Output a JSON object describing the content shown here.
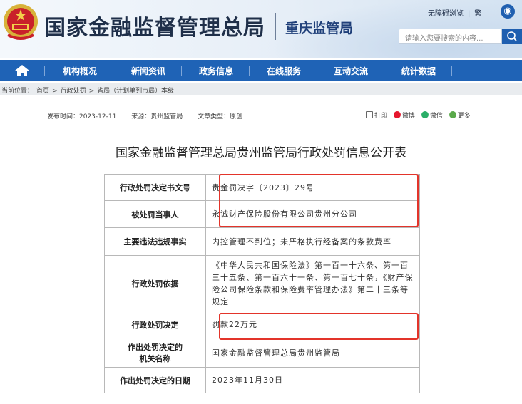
{
  "header": {
    "site_title": "国家金融监督管理总局",
    "branch_title": "重庆监管局",
    "accessible_label": "无障碍浏览",
    "traditional_label": "繁",
    "search_placeholder": "请输入您要搜索的内容...",
    "accent": "#1f63b6"
  },
  "nav": {
    "items": [
      "机构概况",
      "新闻资讯",
      "政务信息",
      "在线服务",
      "互动交流",
      "统计数据"
    ]
  },
  "breadcrumb": {
    "label": "当前位置：",
    "items": [
      "首页",
      "行政处罚",
      "省局（计划单列市局）本级"
    ],
    "separator": ">"
  },
  "meta": {
    "publish_time": "发布时间：2023-12-11",
    "source": "来源：贵州监管局",
    "doc_type": "文章类型：原创"
  },
  "share": {
    "print": "打印",
    "weibo": "微博",
    "wechat": "微信",
    "more": "更多"
  },
  "article": {
    "title": "国家金融监督管理总局贵州监管局行政处罚信息公开表"
  },
  "penalty_table": [
    {
      "key": "行政处罚决定书文号",
      "value": "贵金罚决字〔2023〕29号"
    },
    {
      "key": "被处罚当事人",
      "value": "永诚财产保险股份有限公司贵州分公司"
    },
    {
      "key": "主要违法违规事实",
      "value": "内控管理不到位；未严格执行经备案的条款费率"
    },
    {
      "key": "行政处罚依据",
      "value": "《中华人民共和国保险法》第一百一十六条、第一百三十五条、第一百六十一条、第一百七十条，《财产保险公司保险条款和保险费率管理办法》第二十三条等规定"
    },
    {
      "key": "行政处罚决定",
      "value": "罚款22万元"
    },
    {
      "key_lines": [
        "作出处罚决定的",
        "机关名称"
      ],
      "value": "国家金融监督管理总局贵州监管局"
    },
    {
      "key": "作出处罚决定的日期",
      "value": "2023年11月30日"
    }
  ],
  "highlight_color": "#e3342a"
}
